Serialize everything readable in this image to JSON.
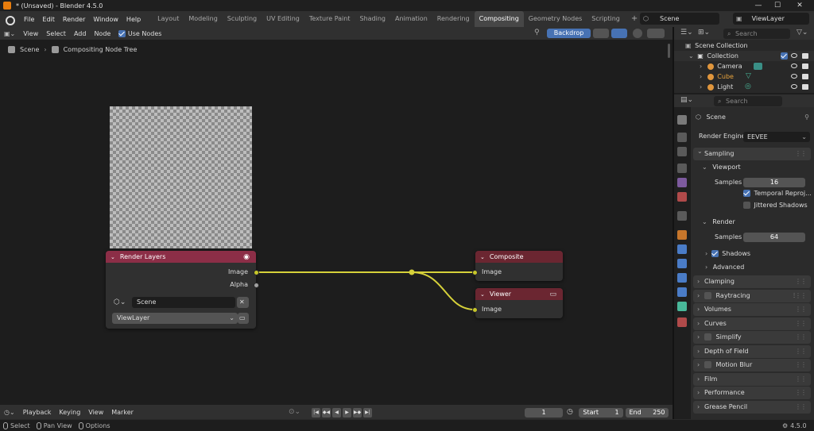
{
  "window": {
    "title": "* (Unsaved) - Blender 4.5.0",
    "version": "4.5.0"
  },
  "topbar": {
    "menus": [
      "File",
      "Edit",
      "Render",
      "Window",
      "Help"
    ],
    "workspaces": [
      "Layout",
      "Modeling",
      "Sculpting",
      "UV Editing",
      "Texture Paint",
      "Shading",
      "Animation",
      "Rendering",
      "Compositing",
      "Geometry Nodes",
      "Scripting"
    ],
    "active_workspace": "Compositing",
    "scene": "Scene",
    "view_layer": "ViewLayer"
  },
  "node_editor": {
    "menus": [
      "View",
      "Select",
      "Add",
      "Node"
    ],
    "use_nodes_label": "Use Nodes",
    "use_nodes_checked": true,
    "backdrop_label": "Backdrop",
    "breadcrumb": [
      "Scene",
      "Compositing Node Tree"
    ]
  },
  "nodes": {
    "render_layers": {
      "title": "Render Layers",
      "color": "#8c2e47",
      "outputs": [
        "Image",
        "Alpha"
      ],
      "scene_field": "Scene",
      "layer_field": "ViewLayer"
    },
    "composite": {
      "title": "Composite",
      "color": "#6b2631",
      "inputs": [
        "Image"
      ]
    },
    "viewer": {
      "title": "Viewer",
      "color": "#6b2631",
      "inputs": [
        "Image"
      ]
    }
  },
  "timeline": {
    "menus": [
      "Playback",
      "Keying",
      "View",
      "Marker"
    ],
    "current_frame": "1",
    "start_label": "Start",
    "start_value": "1",
    "end_label": "End",
    "end_value": "250"
  },
  "statusbar": {
    "items": [
      "Select",
      "Pan View",
      "Options"
    ],
    "version": "4.5.0"
  },
  "outliner": {
    "search_placeholder": "Search",
    "rows": [
      "Scene Collection",
      "Collection",
      "Camera",
      "Cube",
      "Light"
    ]
  },
  "properties": {
    "search_placeholder": "Search",
    "context": "Scene",
    "render_engine_label": "Render Engine",
    "render_engine_value": "EEVEE",
    "sampling": "Sampling",
    "viewport": "Viewport",
    "viewport_samples_label": "Samples",
    "viewport_samples_value": "16",
    "temporal_reprojection": "Temporal Reproj...",
    "jittered_shadows": "Jittered Shadows",
    "render": "Render",
    "render_samples_label": "Samples",
    "render_samples_value": "64",
    "shadows": "Shadows",
    "advanced": "Advanced",
    "panels": [
      "Clamping",
      "Raytracing",
      "Volumes",
      "Curves",
      "Simplify",
      "Depth of Field",
      "Motion Blur",
      "Film",
      "Performance",
      "Grease Pencil"
    ]
  },
  "colors": {
    "accent": "#4772b3",
    "socket_yellow": "#c7c729",
    "link_yellow": "#d6d13a"
  }
}
